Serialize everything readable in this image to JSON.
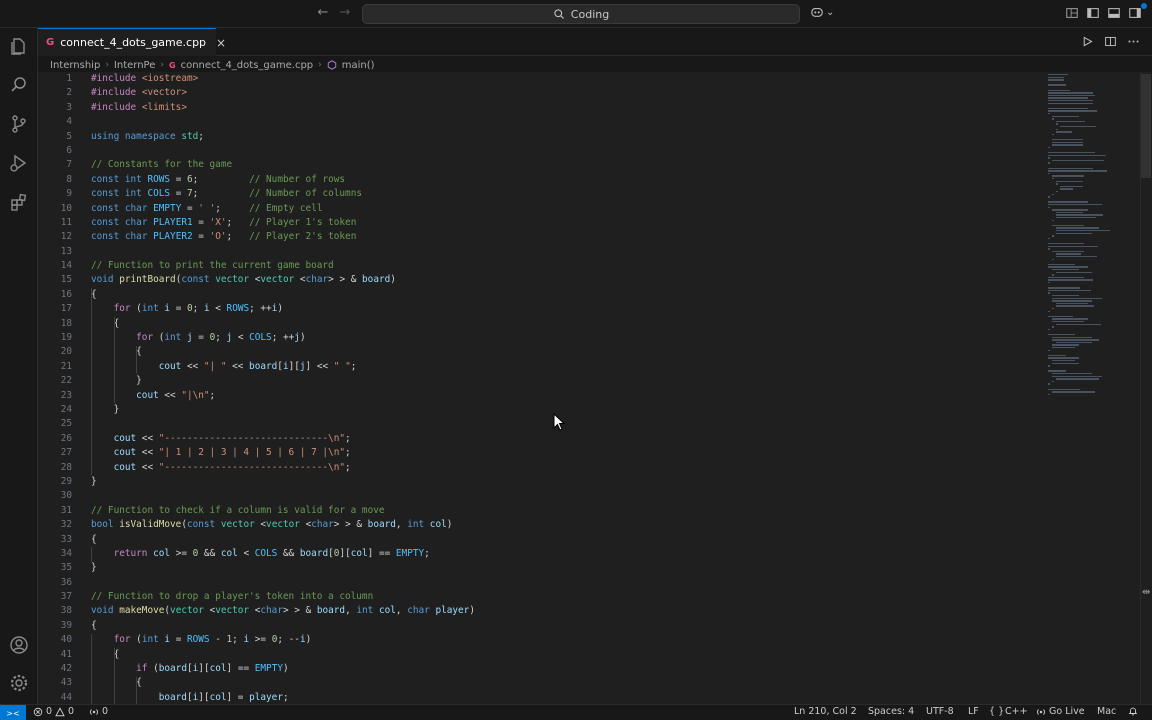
{
  "titlebar": {
    "search_text": "Coding",
    "back_glyph": "←",
    "forward_glyph": "→",
    "copilot_chevron": "⌄"
  },
  "tabs": [
    {
      "label": "connect_4_dots_game.cpp",
      "icon": "cpp-file-icon",
      "close": "×",
      "active": true
    }
  ],
  "breadcrumb": {
    "items": [
      "Internship",
      "InternPe",
      "connect_4_dots_game.cpp",
      "main()"
    ],
    "separator": "›",
    "file_icon_glyph": "G"
  },
  "editor": {
    "language": "C++",
    "line_numbers": [
      "1",
      "2",
      "3",
      "4",
      "5",
      "6",
      "7",
      "8",
      "9",
      "10",
      "11",
      "12",
      "13",
      "14",
      "15",
      "16",
      "17",
      "18",
      "19",
      "20",
      "21",
      "22",
      "23",
      "24",
      "25",
      "26",
      "27",
      "28",
      "29",
      "30",
      "31",
      "32",
      "33",
      "34",
      "35",
      "36",
      "37",
      "38",
      "39",
      "40",
      "41",
      "42",
      "43",
      "44"
    ],
    "lines": [
      "#include <iostream>",
      "#include <vector>",
      "#include <limits>",
      "",
      "using namespace std;",
      "",
      "// Constants for the game",
      "const int ROWS = 6;         // Number of rows",
      "const int COLS = 7;         // Number of columns",
      "const char EMPTY = ' ';     // Empty cell",
      "const char PLAYER1 = 'X';   // Player 1's token",
      "const char PLAYER2 = 'O';   // Player 2's token",
      "",
      "// Function to print the current game board",
      "void printBoard(const vector <vector <char> > & board)",
      "{",
      "    for (int i = 0; i < ROWS; ++i)",
      "    {",
      "        for (int j = 0; j < COLS; ++j)",
      "        {",
      "            cout << \"| \" << board[i][j] << \" \";",
      "        }",
      "        cout << \"|\\n\";",
      "    }",
      "",
      "    cout << \"-----------------------------\\n\";",
      "    cout << \"| 1 | 2 | 3 | 4 | 5 | 6 | 7 |\\n\";",
      "    cout << \"-----------------------------\\n\";",
      "}",
      "",
      "// Function to check if a column is valid for a move",
      "bool isValidMove(const vector <vector <char> > & board, int col)",
      "{",
      "    return col >= 0 && col < COLS && board[0][col] == EMPTY;",
      "}",
      "",
      "// Function to drop a player's token into a column",
      "void makeMove(vector <vector <char> > & board, int col, char player)",
      "{",
      "    for (int i = ROWS - 1; i >= 0; --i)",
      "    {",
      "        if (board[i][col] == EMPTY)",
      "        {",
      "            board[i][col] = player;"
    ]
  },
  "statusbar": {
    "remote_glyph": "><",
    "errors": "0",
    "warnings": "0",
    "ports": "0",
    "cursor_position": "Ln 210, Col 2",
    "spaces": "Spaces: 4",
    "encoding": "UTF-8",
    "eol": "LF",
    "language_icon": "{ }",
    "language": "C++",
    "go_live": "Go Live",
    "platform": "Mac"
  },
  "colors": {
    "accent": "#0078d4",
    "editor_bg": "#1f1f1f",
    "chrome_bg": "#181818"
  }
}
